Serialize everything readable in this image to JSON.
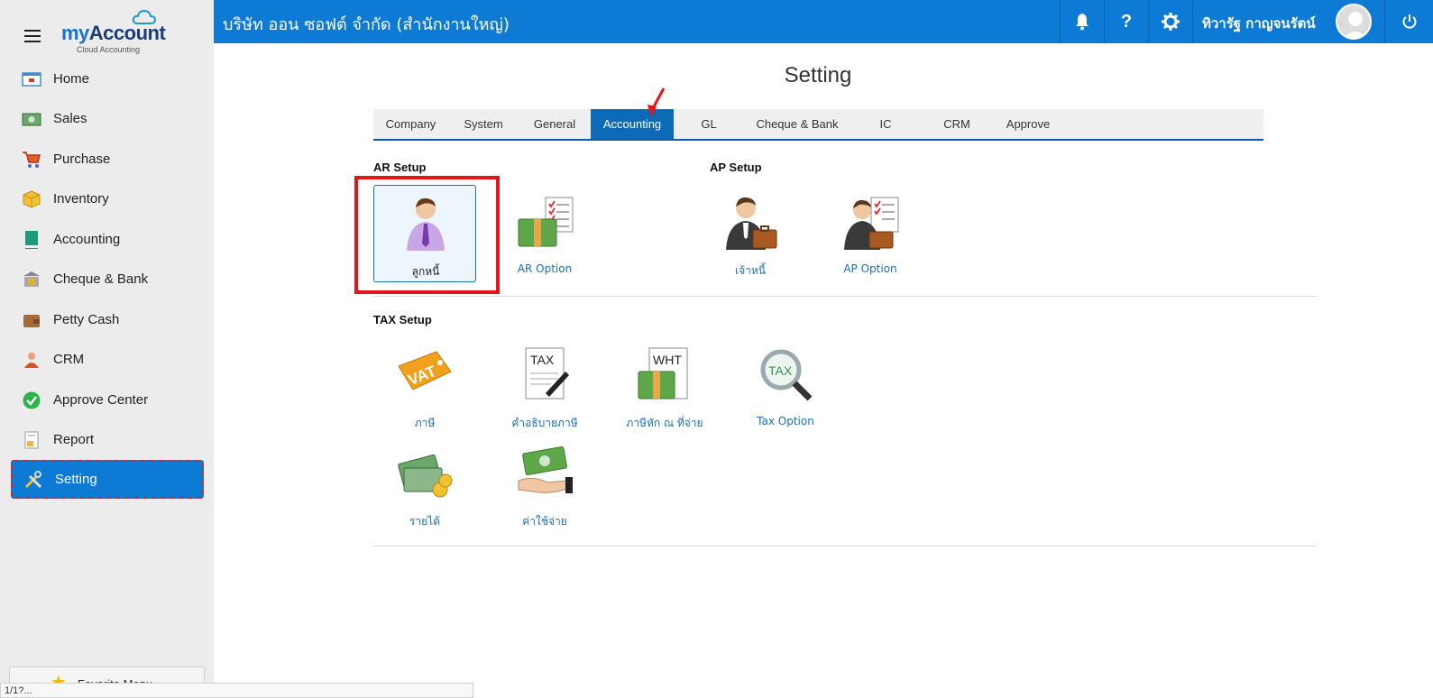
{
  "header": {
    "company": "บริษัท ออน ซอฟต์ จำกัด (สำนักงานใหญ่)",
    "user_name": "ทิวารัฐ กาญจนรัตน์",
    "help_label": "?"
  },
  "logo": {
    "name_my": "my",
    "name_account": "Account",
    "subtitle": "Cloud Accounting"
  },
  "sidebar": {
    "items": [
      {
        "label": "Home",
        "icon": "home-icon"
      },
      {
        "label": "Sales",
        "icon": "sales-icon"
      },
      {
        "label": "Purchase",
        "icon": "cart-icon"
      },
      {
        "label": "Inventory",
        "icon": "box-icon"
      },
      {
        "label": "Accounting",
        "icon": "book-icon"
      },
      {
        "label": "Cheque & Bank",
        "icon": "bank-icon"
      },
      {
        "label": "Petty Cash",
        "icon": "wallet-icon"
      },
      {
        "label": "CRM",
        "icon": "people-icon"
      },
      {
        "label": "Approve Center",
        "icon": "check-circle-icon"
      },
      {
        "label": "Report",
        "icon": "report-icon"
      },
      {
        "label": "Setting",
        "icon": "tools-icon",
        "active": true
      }
    ],
    "favorite_label": "Favorite Menu"
  },
  "status_url": "1/1?...",
  "main": {
    "title": "Setting",
    "tabs": [
      {
        "label": "Company"
      },
      {
        "label": "System"
      },
      {
        "label": "General"
      },
      {
        "label": "Accounting",
        "active": true
      },
      {
        "label": "GL"
      },
      {
        "label": "Cheque & Bank"
      },
      {
        "label": "IC"
      },
      {
        "label": "CRM"
      },
      {
        "label": "Approve"
      }
    ],
    "sections": {
      "ar_title": "AR Setup",
      "ap_title": "AP Setup",
      "tax_title": "TAX Setup"
    },
    "tiles": {
      "debtor": "ลูกหนี้",
      "ar_option": "AR Option",
      "creditor": "เจ้าหนี้",
      "ap_option": "AP Option",
      "tax": "ภาษี",
      "tax_desc": "คำอธิบายภาษี",
      "wht": "ภาษีหัก ณ ที่จ่าย",
      "tax_option": "Tax Option",
      "income": "รายได้",
      "expense": "ค่าใช้จ่าย"
    },
    "icon_text": {
      "vat": "VAT",
      "tax_doc": "TAX",
      "wht_doc": "WHT",
      "tax_lens": "TAX"
    }
  },
  "colors": {
    "primary": "#0d7ad6",
    "highlight": "#e3161b",
    "link": "#1a6fc0"
  }
}
